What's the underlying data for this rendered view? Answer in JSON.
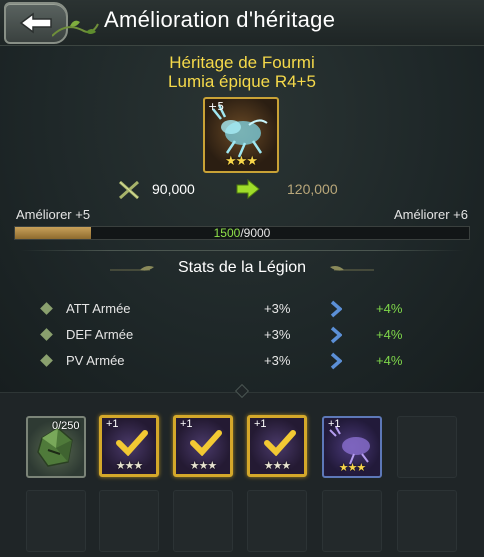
{
  "header": {
    "title": "Amélioration d'héritage",
    "back_icon": "back-arrow-icon"
  },
  "item": {
    "name_line1": "Héritage de Fourmi",
    "name_line2": "Lumia épique R4+5",
    "level_tag": "+5",
    "stars": "★★★",
    "icon": "ant-creature-icon"
  },
  "power": {
    "icon": "crossed-swords-icon",
    "current": "90,000",
    "arrow_icon": "right-arrow-icon",
    "next": "120,000"
  },
  "enhance": {
    "left_label": "Améliorer +5",
    "right_label": "Améliorer +6",
    "progress_current": "1500",
    "progress_max": "/9000",
    "progress_fraction": 0.1667
  },
  "stats": {
    "title": "Stats de la Légion",
    "rows": [
      {
        "name": "ATT Armée",
        "current": "+3%",
        "next": "+4%"
      },
      {
        "name": "DEF Armée",
        "current": "+3%",
        "next": "+4%"
      },
      {
        "name": "PV Armée",
        "current": "+3%",
        "next": "+4%"
      }
    ]
  },
  "materials": {
    "stone": {
      "count": "0/250",
      "icon": "green-crystal-icon"
    },
    "slots": [
      {
        "level": "+1",
        "stars": "★★★",
        "checked": true
      },
      {
        "level": "+1",
        "stars": "★★★",
        "checked": true
      },
      {
        "level": "+1",
        "stars": "★★★",
        "checked": true
      },
      {
        "level": "+1",
        "stars": "★★★",
        "checked": false
      }
    ]
  },
  "colors": {
    "accent_gold": "#d4a82a",
    "name_yellow": "#f5d94a",
    "progress_green": "#8fe04a",
    "stat_green": "#7ed64a",
    "chevron_blue": "#5b8fd6"
  }
}
